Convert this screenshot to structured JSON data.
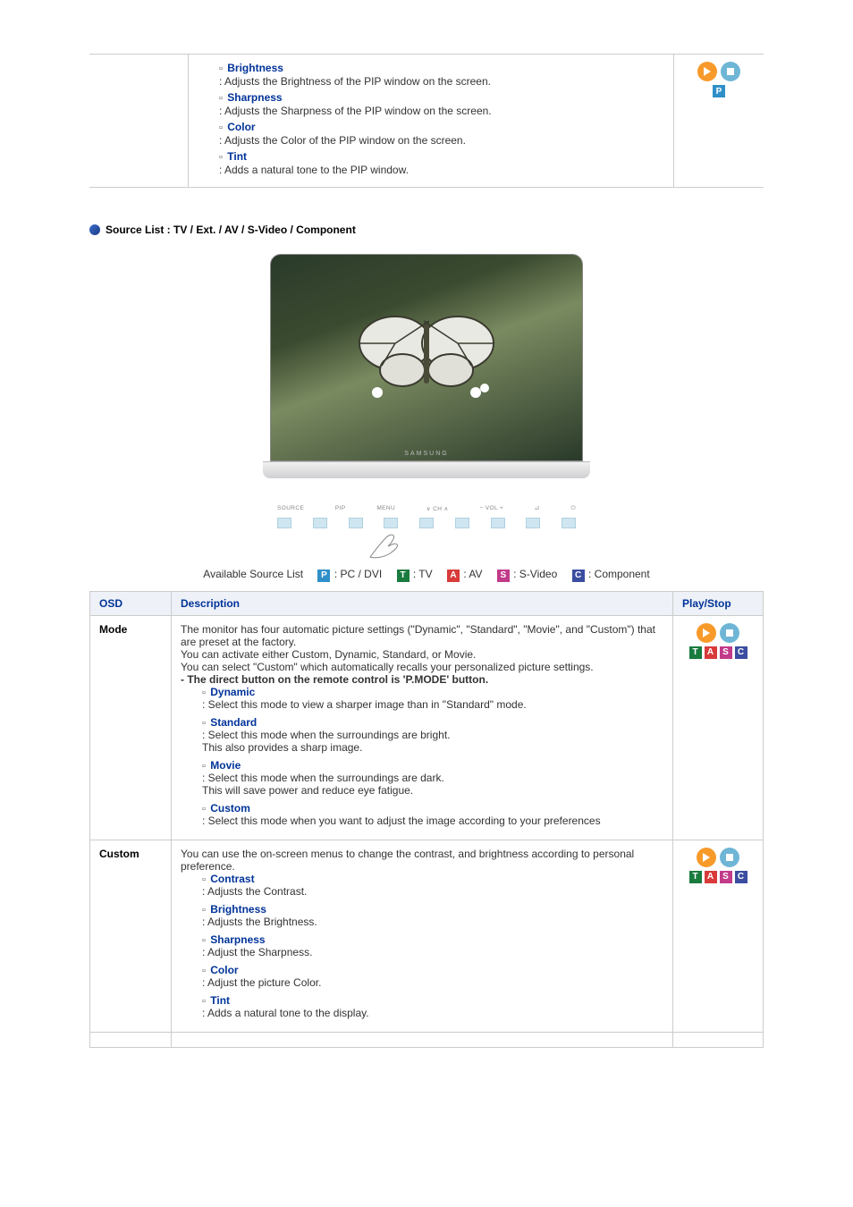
{
  "top_row": {
    "items": [
      {
        "term": "Brightness",
        "desc": ": Adjusts the Brightness of the PIP window on the screen."
      },
      {
        "term": "Sharpness",
        "desc": ": Adjusts the Sharpness of the PIP window on the screen."
      },
      {
        "term": "Color",
        "desc": ": Adjusts the Color of the PIP window on the screen."
      },
      {
        "term": "Tint",
        "desc": ": Adds a natural tone to the PIP window."
      }
    ]
  },
  "section_title": "Source List : TV / Ext. / AV / S-Video / Component",
  "monitor": {
    "brand": "SAMSUNG",
    "buttons": [
      "SOURCE",
      "PIP",
      "MENU",
      "∨  CH  ∧",
      "−    VOL    +",
      "⏎",
      "⏻"
    ]
  },
  "available_label": "Available Source List",
  "sources": [
    {
      "code": "P",
      "label": ": PC / DVI"
    },
    {
      "code": "T",
      "label": ": TV"
    },
    {
      "code": "A",
      "label": ": AV"
    },
    {
      "code": "S",
      "label": ": S-Video"
    },
    {
      "code": "C",
      "label": ": Component"
    }
  ],
  "table": {
    "headers": {
      "osd": "OSD",
      "desc": "Description",
      "play": "Play/Stop"
    },
    "rows": [
      {
        "osd": "Mode",
        "intro_lines": [
          "The monitor has four automatic picture settings (\"Dynamic\", \"Standard\", \"Movie\", and \"Custom\") that are preset at the factory.",
          "You can activate either Custom, Dynamic, Standard, or Movie.",
          "You can select \"Custom\" which automatically recalls your personalized picture settings."
        ],
        "bold_line": "- The direct button on the remote control is 'P.MODE' button.",
        "bullets": [
          {
            "term": "Dynamic",
            "desc": ": Select this mode to view a sharper image than in \"Standard\" mode."
          },
          {
            "term": "Standard",
            "desc": ": Select this mode when the surroundings are bright.\nThis also provides a sharp image."
          },
          {
            "term": "Movie",
            "desc": ": Select this mode when the surroundings are dark.\nThis will save power and reduce eye fatigue."
          },
          {
            "term": "Custom",
            "desc": ": Select this mode when you want to adjust the image according to your preferences"
          }
        ],
        "badges": [
          "T",
          "A",
          "S",
          "C"
        ]
      },
      {
        "osd": "Custom",
        "intro_lines": [
          "You can use the on-screen menus to change the contrast, and brightness according to personal preference."
        ],
        "bullets": [
          {
            "term": "Contrast",
            "desc": ": Adjusts the Contrast."
          },
          {
            "term": "Brightness",
            "desc": ": Adjusts the Brightness."
          },
          {
            "term": "Sharpness",
            "desc": ": Adjust the Sharpness."
          },
          {
            "term": "Color",
            "desc": ": Adjust the picture Color."
          },
          {
            "term": "Tint",
            "desc": ": Adds a natural tone to the display."
          }
        ],
        "badges": [
          "T",
          "A",
          "S",
          "C"
        ]
      }
    ]
  }
}
